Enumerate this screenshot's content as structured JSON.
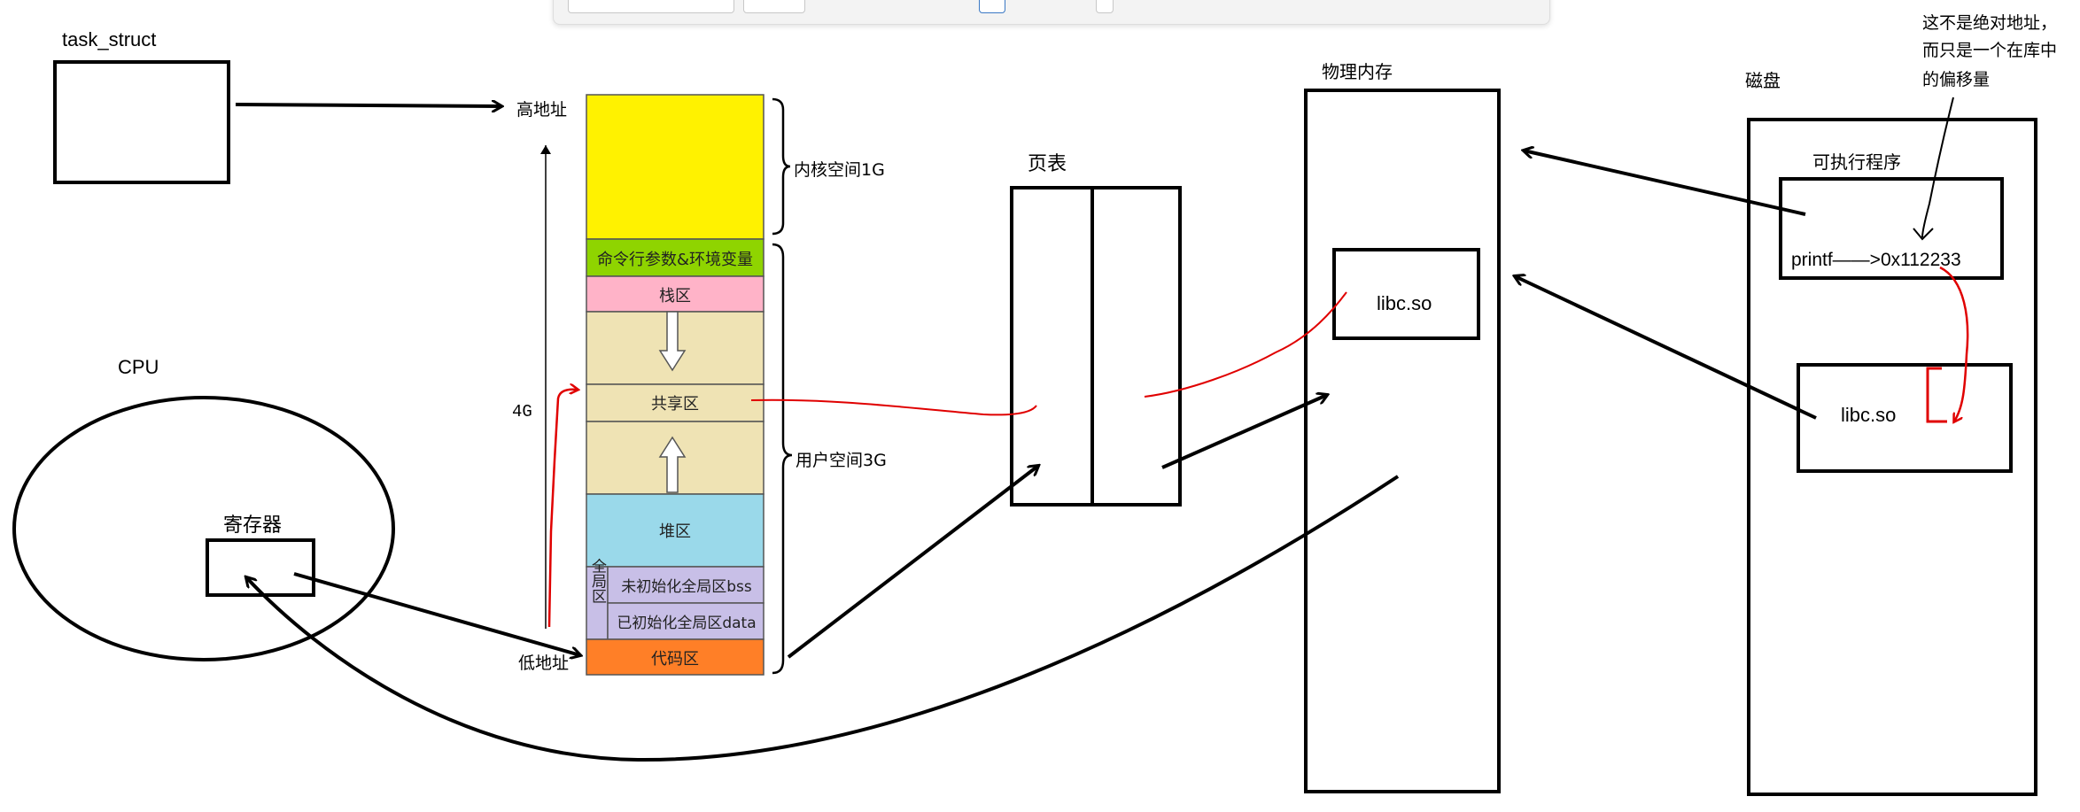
{
  "labels": {
    "task_struct": "task_struct",
    "cpu": "CPU",
    "register": "寄存器",
    "high_addr": "高地址",
    "low_addr": "低地址",
    "four_g": "4G",
    "kernel_space": "内核空间1G",
    "user_space": "用户空间3G",
    "page_table": "页表",
    "phys_mem": "物理内存",
    "libc_mem": "libc.so",
    "disk": "磁盘",
    "exec_program": "可执行程序",
    "printf_line": "printf——>0x112233",
    "libc_disk": "libc.so",
    "note_line1": "这不是绝对地址，",
    "note_line2": "而只是一个在库中",
    "note_line3": "的偏移量"
  },
  "segments": {
    "cmdline": "命令行参数&环境变量",
    "stack": "栈区",
    "shared": "共享区",
    "heap": "堆区",
    "bss": "未初始化全局区bss",
    "data": "已初始化全局区data",
    "code": "代码区",
    "global_side": "全局区"
  },
  "colors": {
    "kernel": "#fff200",
    "cmdline": "#8fd400",
    "stack": "#ffb3c8",
    "user_gap": "#efe3b4",
    "heap": "#9ad9ea",
    "global": "#c8bfe7",
    "code": "#ff7f27",
    "red": "#e00000"
  }
}
